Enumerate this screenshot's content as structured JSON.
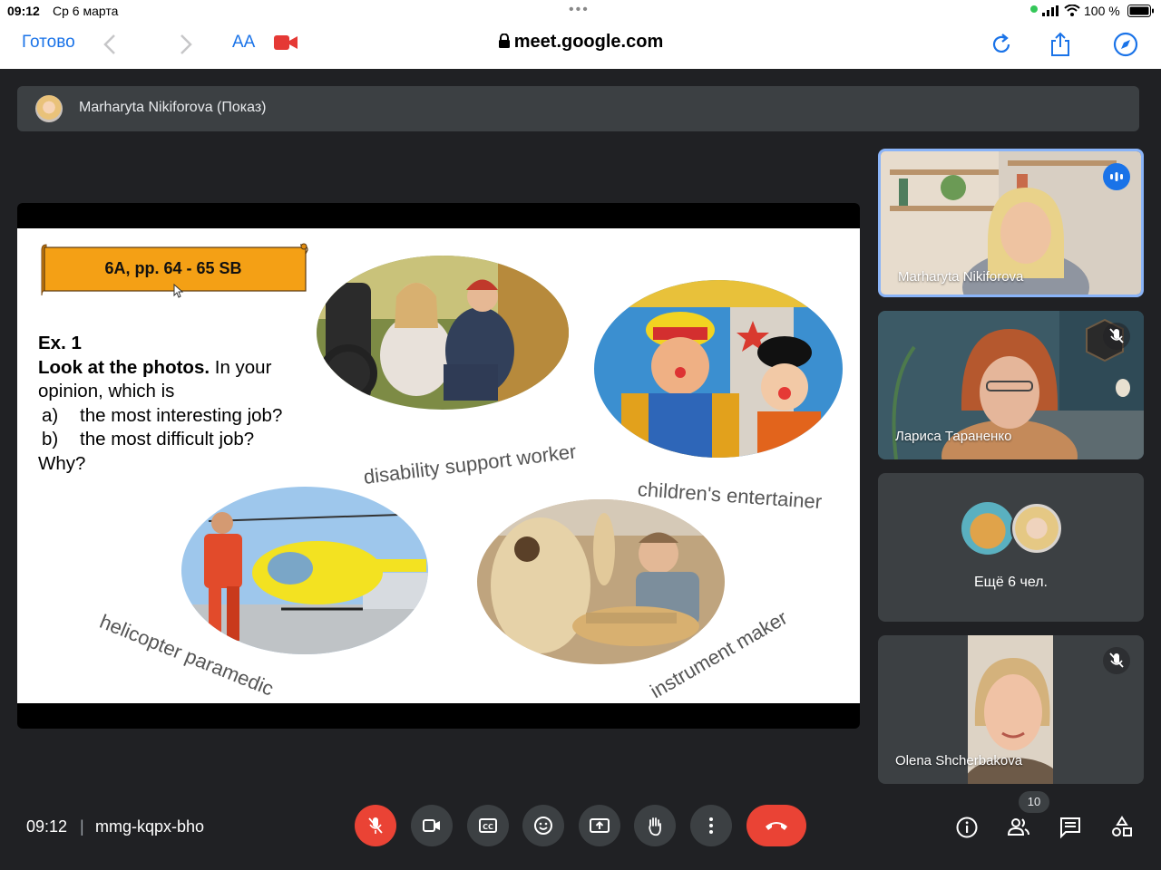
{
  "status_bar": {
    "time": "09:12",
    "date": "Ср 6 марта",
    "battery": "100 %"
  },
  "browser": {
    "done_label": "Готово",
    "text_size_label": "AA",
    "url": "meet.google.com"
  },
  "presenter": {
    "label": "Marharyta Nikiforova (Показ)"
  },
  "slide": {
    "banner": "6A, pp. 64 - 65 SB",
    "exercise_number": "Ex. 1",
    "instruction_bold": "Look at the photos.",
    "instruction_rest_1": " In your",
    "instruction_line2": "opinion, which is",
    "options": [
      {
        "letter": "a)",
        "text": "the most interesting job?"
      },
      {
        "letter": "b)",
        "text": "the most difficult job?"
      }
    ],
    "why": "Why?",
    "captions": {
      "disability": "disability support worker",
      "children": "children's entertainer",
      "helicopter": "helicopter paramedic",
      "instrument": "instrument maker"
    }
  },
  "participants": [
    {
      "name": "Marharyta Nikiforova",
      "speaking": true
    },
    {
      "name": "Лариса Тараненко",
      "muted": true
    },
    {
      "name": "Ещё 6 чел."
    },
    {
      "name": "Olena Shcherbakova",
      "muted": true
    }
  ],
  "meeting": {
    "time": "09:12",
    "separator": "|",
    "code": "mmg-kqpx-bho",
    "participant_count": "10"
  },
  "colors": {
    "accent": "#1a73e8",
    "end_call": "#ea4335",
    "banner": "#f4a015"
  }
}
